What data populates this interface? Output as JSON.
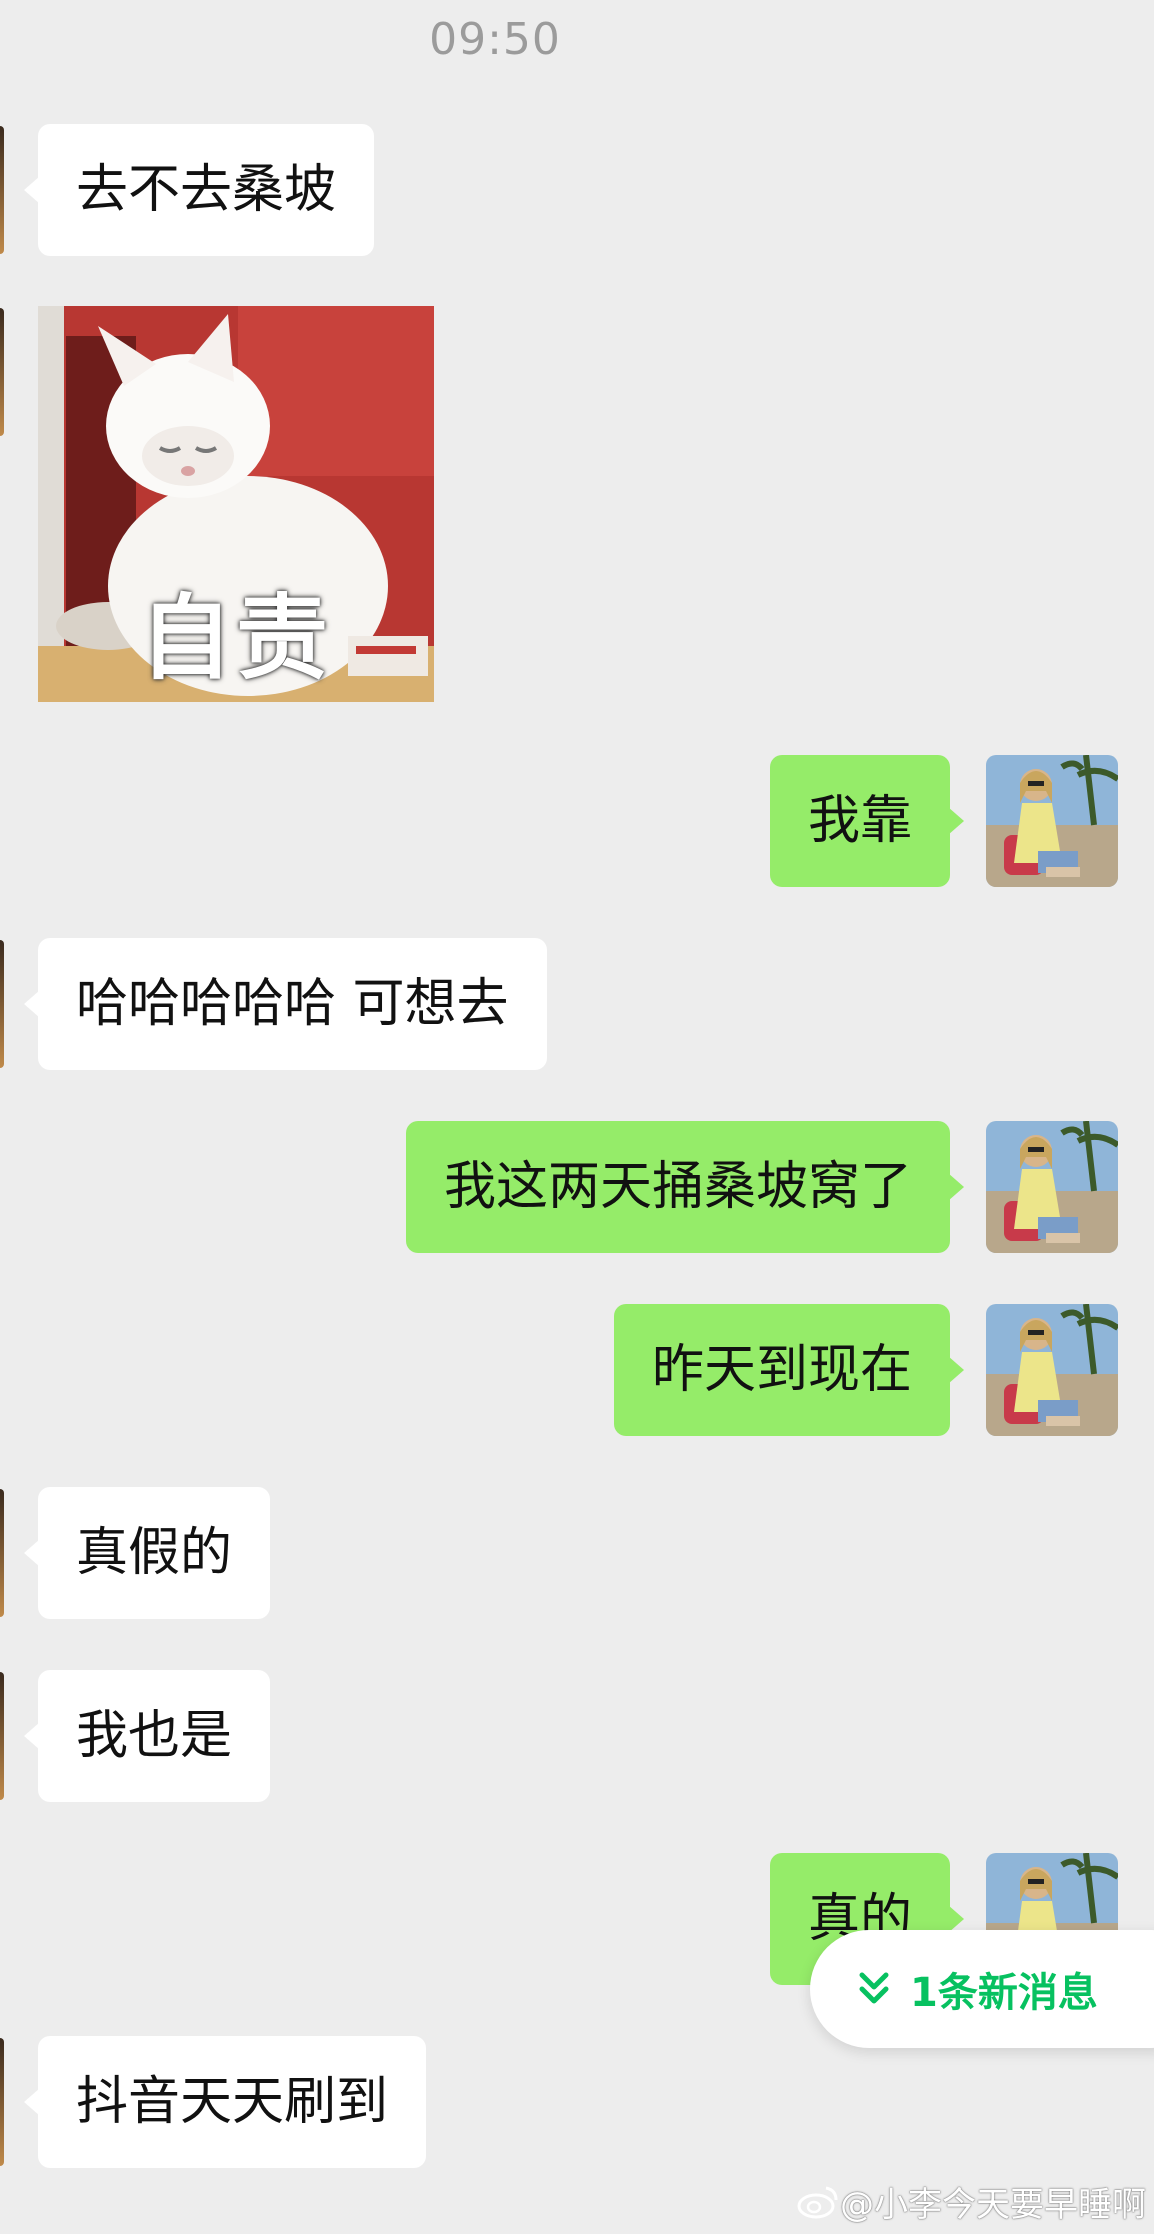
{
  "header": {
    "timestamp": "09:50"
  },
  "messages": [
    {
      "side": "in",
      "type": "text",
      "text": "去不去桑坡"
    },
    {
      "side": "in",
      "type": "sticker",
      "caption": "自责",
      "icon": "white-cat-sticker"
    },
    {
      "side": "out",
      "type": "text",
      "text": "我靠"
    },
    {
      "side": "in",
      "type": "text",
      "text": "哈哈哈哈哈 可想去"
    },
    {
      "side": "out",
      "type": "text",
      "text": "我这两天捅桑坡窝了"
    },
    {
      "side": "out",
      "type": "text",
      "text": "昨天到现在"
    },
    {
      "side": "in",
      "type": "text",
      "text": "真假的"
    },
    {
      "side": "in",
      "type": "text",
      "text": "我也是"
    },
    {
      "side": "out",
      "type": "text",
      "text": "真的"
    },
    {
      "side": "in",
      "type": "text",
      "text": "抖音天天刷到"
    }
  ],
  "new_message_pill": {
    "label": "1条新消息",
    "icon": "double-chevron-down-icon"
  },
  "watermark": {
    "text": "@小李今天要早睡啊",
    "icon": "weibo-icon"
  },
  "colors": {
    "background": "#ededed",
    "incoming_bubble": "#ffffff",
    "outgoing_bubble": "#95ec69",
    "accent_green": "#07c160"
  }
}
